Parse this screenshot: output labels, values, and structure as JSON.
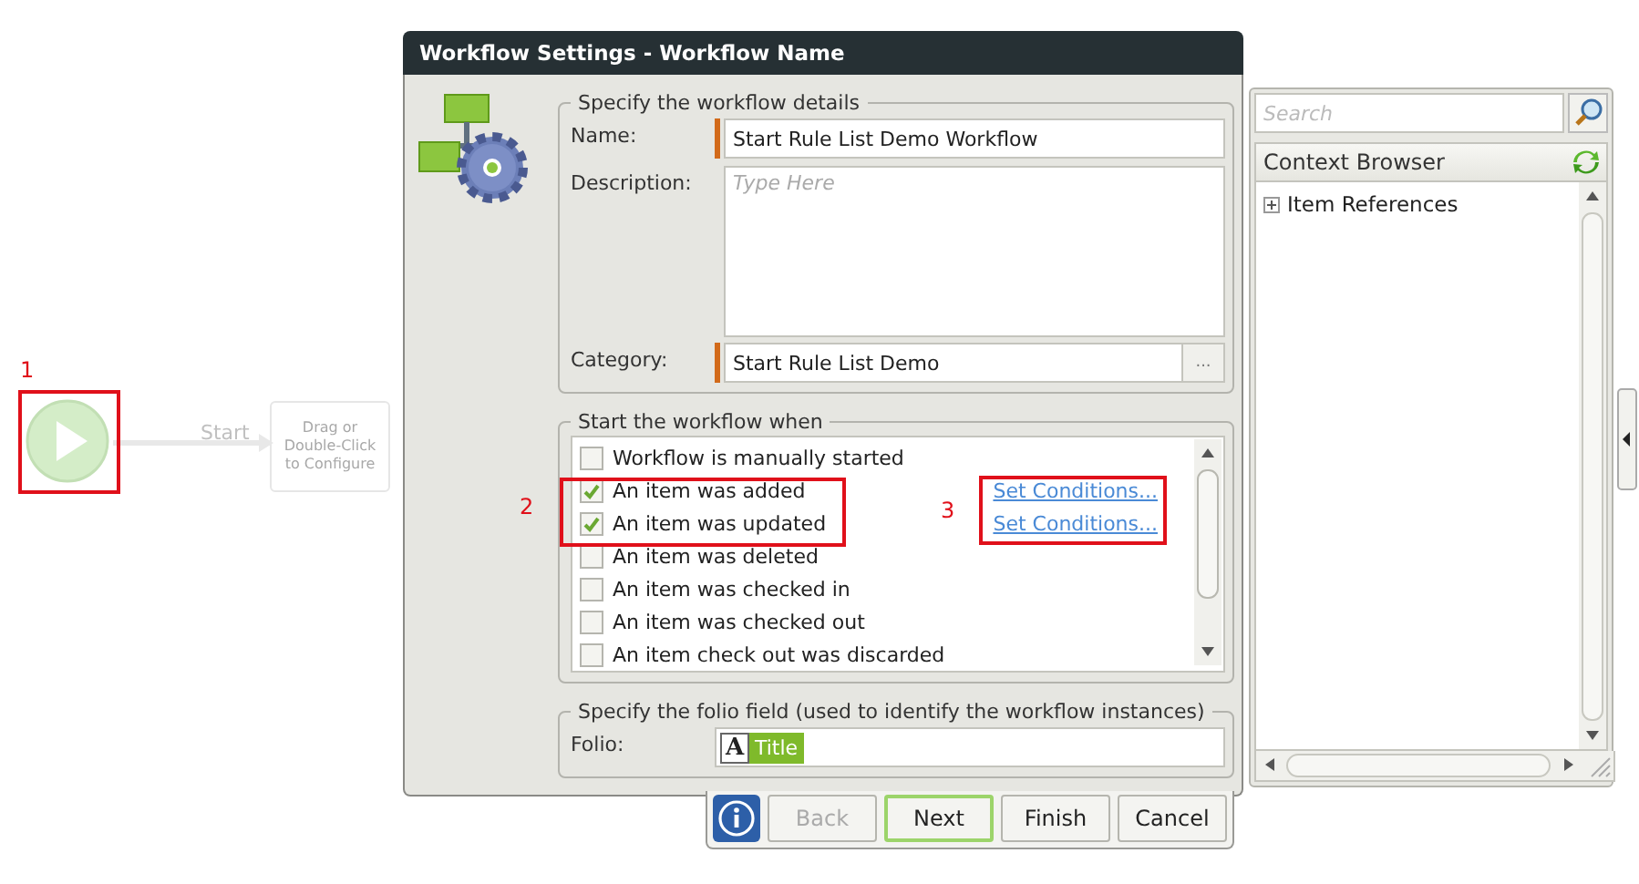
{
  "canvas": {
    "start_label": "Start",
    "placeholder_node": [
      "Drag or",
      "Double-Click",
      "to Configure"
    ]
  },
  "annotations": [
    {
      "label": "1"
    },
    {
      "label": "2"
    },
    {
      "label": "3"
    }
  ],
  "dialog": {
    "title": "Workflow Settings - Workflow Name",
    "details": {
      "legend": "Specify the workflow details",
      "fields": [
        {
          "kind": "input",
          "label": "Name:",
          "value": "Start Rule List Demo Workflow",
          "required": true
        },
        {
          "kind": "textarea",
          "label": "Description:",
          "placeholder": "Type Here",
          "required": false
        },
        {
          "kind": "browse",
          "label": "Category:",
          "value": "Start Rule List Demo",
          "required": true,
          "button": "..."
        }
      ]
    },
    "triggers": {
      "legend": "Start the workflow when",
      "items": [
        {
          "label": "Workflow is manually started",
          "checked": false
        },
        {
          "label": "An item was added",
          "checked": true,
          "link": "Set Conditions..."
        },
        {
          "label": "An item was updated",
          "checked": true,
          "link": "Set Conditions..."
        },
        {
          "label": "An item was deleted",
          "checked": false
        },
        {
          "label": "An item was checked in",
          "checked": false
        },
        {
          "label": "An item was checked out",
          "checked": false
        },
        {
          "label": "An item check out was discarded",
          "checked": false
        }
      ]
    },
    "folio": {
      "legend": "Specify the folio field (used to identify the workflow instances)",
      "label": "Folio:",
      "token_icon": "A",
      "token": "Title"
    },
    "buttons": [
      {
        "label": "Back",
        "disabled": true,
        "focused": false
      },
      {
        "label": "Next",
        "disabled": false,
        "focused": true
      },
      {
        "label": "Finish",
        "disabled": false,
        "focused": false
      },
      {
        "label": "Cancel",
        "disabled": false,
        "focused": false
      }
    ]
  },
  "side_panel": {
    "search": {
      "placeholder": "Search"
    },
    "header": "Context Browser",
    "tree": [
      {
        "label": "Item References",
        "expanded": false
      }
    ]
  }
}
